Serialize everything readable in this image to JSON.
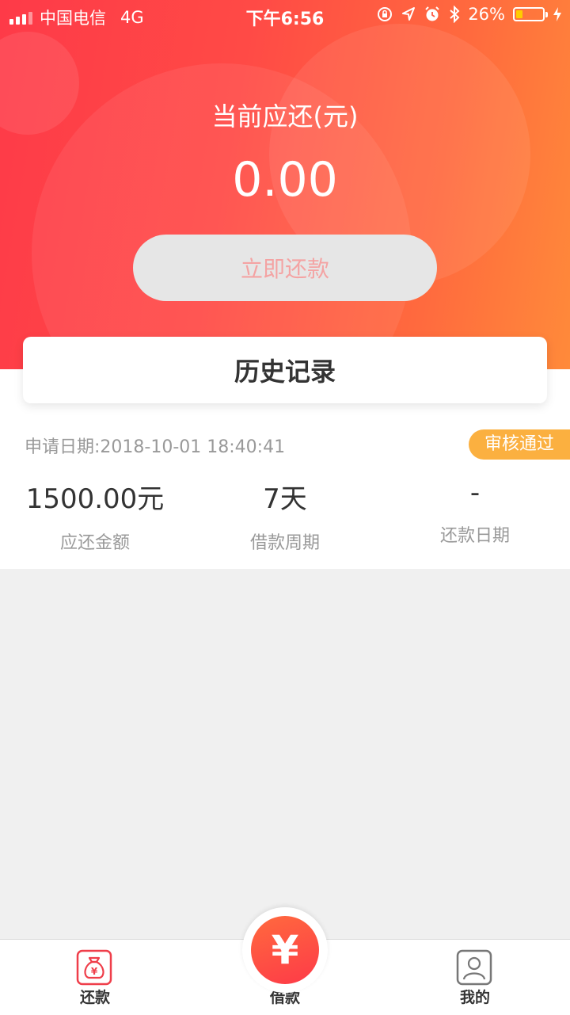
{
  "status_bar": {
    "carrier": "中国电信",
    "network": "4G",
    "time": "下午6:56",
    "battery": "26%",
    "battery_level": 0.26
  },
  "hero": {
    "title": "当前应还(元)",
    "amount": "0.00",
    "repay_button": "立即还款"
  },
  "history": {
    "title": "历史记录",
    "record": {
      "apply_date": "申请日期:2018-10-01 18:40:41",
      "status": "审核通过",
      "columns": [
        {
          "value": "1500.00元",
          "label": "应还金额"
        },
        {
          "value": "7天",
          "label": "借款周期"
        },
        {
          "value": "-",
          "label": "还款日期"
        }
      ]
    }
  },
  "tabbar": {
    "repay": "还款",
    "borrow": "借款",
    "borrow_symbol": "¥",
    "mine": "我的"
  },
  "colors": {
    "accent": "#fe3a48",
    "status_badge": "#fbb040"
  }
}
